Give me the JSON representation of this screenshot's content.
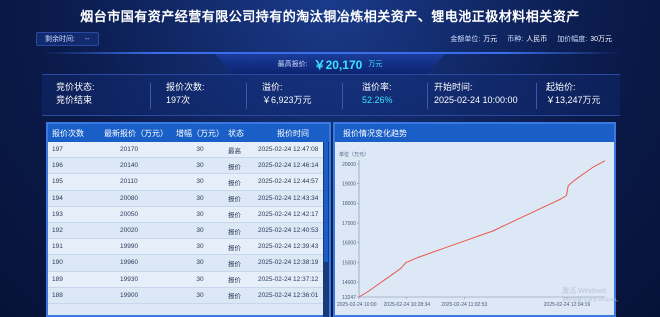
{
  "page": {
    "title": "烟台市国有资产经营有限公司持有的淘汰铜冶炼相关资产、锂电池正极材料相关资产"
  },
  "subbar": {
    "remaining_label": "剩余时间:",
    "remaining_value": "--",
    "amount_unit_label": "金额单位:",
    "amount_unit_value": "万元",
    "currency_label": "币种:",
    "currency_value": "人民币",
    "increment_label": "加价幅度:",
    "increment_value": "30万元"
  },
  "max_price": {
    "label": "最高报价:",
    "currency": "￥",
    "value": "20,170",
    "unit": "万元"
  },
  "stats": [
    {
      "label": "竞价状态:",
      "value": "竞价结束",
      "highlight": false
    },
    {
      "label": "报价次数:",
      "value": "197次",
      "highlight": false
    },
    {
      "label": "溢价:",
      "value": "￥6,923万元",
      "highlight": false
    },
    {
      "label": "溢价率:",
      "value": "52.26%",
      "highlight": true
    },
    {
      "label": "开始时间:",
      "value": "2025-02-24 10:00:00",
      "highlight": false
    },
    {
      "label": "起始价:",
      "value": "￥13,247万元",
      "highlight": false
    }
  ],
  "table": {
    "headers": [
      "报价次数",
      "最新报价（万元）",
      "增幅（万元）",
      "状态",
      "报价时间"
    ],
    "rows": [
      [
        "197",
        "20170",
        "30",
        "最高",
        "2025-02-24 12:47:08"
      ],
      [
        "196",
        "20140",
        "30",
        "报价",
        "2025-02-24 12:46:14"
      ],
      [
        "195",
        "20110",
        "30",
        "报价",
        "2025-02-24 12:44:57"
      ],
      [
        "194",
        "20080",
        "30",
        "报价",
        "2025-02-24 12:43:34"
      ],
      [
        "193",
        "20050",
        "30",
        "报价",
        "2025-02-24 12:42:17"
      ],
      [
        "192",
        "20020",
        "30",
        "报价",
        "2025-02-24 12:40:53"
      ],
      [
        "191",
        "19990",
        "30",
        "报价",
        "2025-02-24 12:39:43"
      ],
      [
        "190",
        "19960",
        "30",
        "报价",
        "2025-02-24 12:38:19"
      ],
      [
        "189",
        "19930",
        "30",
        "报价",
        "2025-02-24 12:37:12"
      ],
      [
        "188",
        "19900",
        "30",
        "报价",
        "2025-02-24 12:36:01"
      ]
    ]
  },
  "trend": {
    "title": "报价情况变化趋势",
    "unit_label": "单位（万元）"
  },
  "chart_data": {
    "type": "line",
    "title": "报价情况变化趋势",
    "ylabel": "单位（万元）",
    "xlabel": "",
    "ylim": [
      13247,
      20000
    ],
    "y_ticks": [
      13247,
      14000,
      15000,
      16000,
      17000,
      18000,
      19000,
      20000
    ],
    "x_ticks": [
      "2025-02-24 10:00",
      "2025-02-24 10:28:34",
      "2025-02-24 11:02:53",
      "2025-02-24 12:04:19"
    ],
    "x_tick_positions_minutes": [
      0,
      28.6,
      62.9,
      124.3
    ],
    "grid": false,
    "series": [
      {
        "color": "#e8584a",
        "x_minutes": [
          0,
          5,
          10,
          15,
          20,
          25,
          28,
          35,
          40,
          45,
          50,
          55,
          60,
          65,
          70,
          75,
          80,
          85,
          90,
          95,
          100,
          105,
          110,
          115,
          120,
          124,
          125,
          127,
          130,
          135,
          140,
          147
        ],
        "values": [
          13247,
          13500,
          13800,
          14100,
          14400,
          14700,
          15000,
          15250,
          15400,
          15550,
          15700,
          15850,
          16000,
          16150,
          16300,
          16450,
          16600,
          16800,
          17000,
          17200,
          17400,
          17600,
          17800,
          18000,
          18200,
          18400,
          18900,
          19050,
          19250,
          19550,
          19850,
          20170
        ]
      }
    ]
  },
  "watermark": {
    "line1": "激活 Windows",
    "line2": "转到\"设置\"以激活 Windows。"
  }
}
